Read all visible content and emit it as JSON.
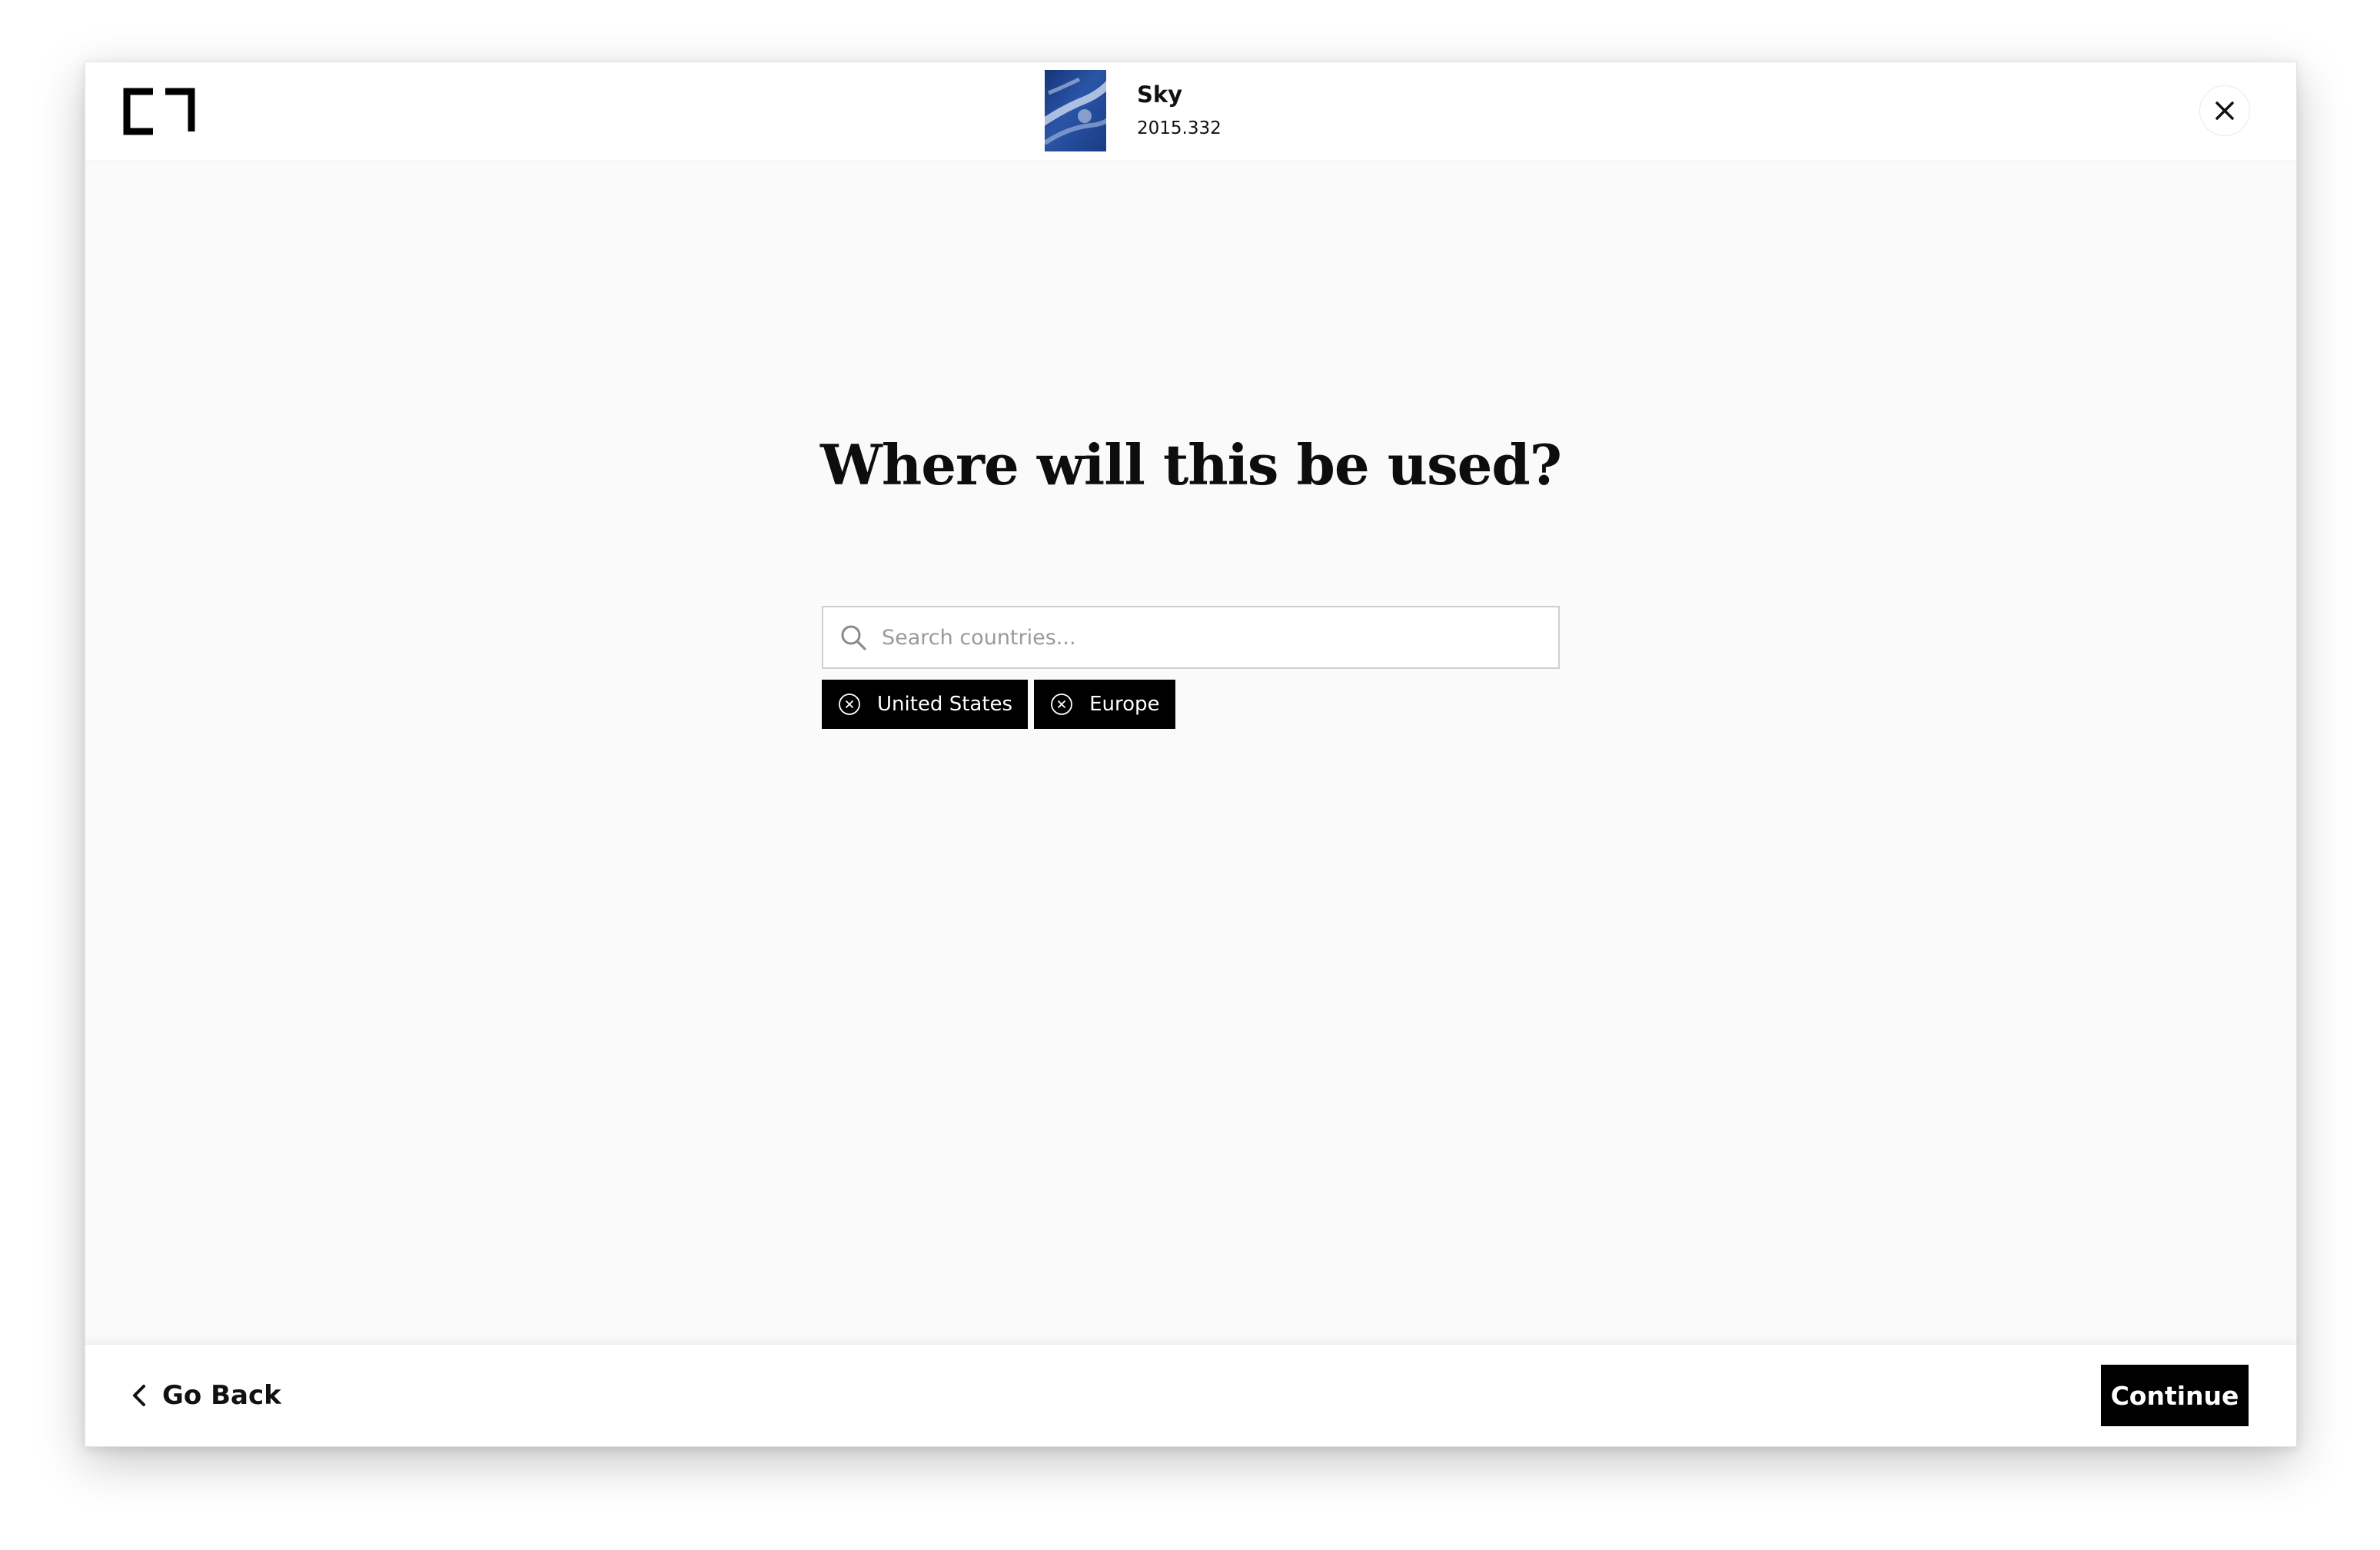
{
  "header": {
    "logo_icon": "bracket-logo-icon",
    "artwork": {
      "title": "Sky",
      "accession": "2015.332",
      "thumbnail_icon": "sky-thumbnail",
      "thumbnail_colors": [
        "#1c3f86",
        "#6c8fcf",
        "#dce6f5"
      ]
    },
    "close_icon": "close-icon"
  },
  "main": {
    "question": "Where will this be used?",
    "search": {
      "placeholder": "Search countries...",
      "value": "",
      "icon": "search-icon"
    },
    "selected_regions": [
      {
        "label": "United States",
        "remove_icon": "circle-x-icon"
      },
      {
        "label": "Europe",
        "remove_icon": "circle-x-icon"
      }
    ]
  },
  "footer": {
    "back_label": "Go Back",
    "back_icon": "chevron-left-icon",
    "continue_label": "Continue"
  },
  "colors": {
    "accent": "#000000",
    "panel_background": "#fafafa",
    "header_background": "#ffffff",
    "input_border": "#cfcfcf"
  }
}
